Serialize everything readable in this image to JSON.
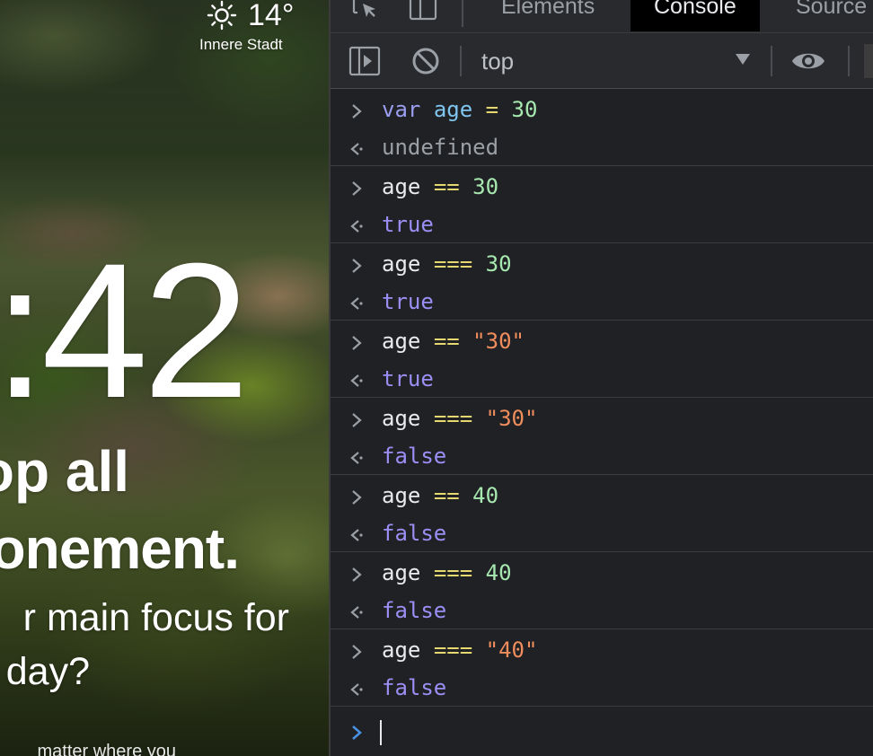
{
  "newtab": {
    "weather": {
      "temp": "14°",
      "location": "Innere Stadt",
      "icon": "sun-icon"
    },
    "clock": ":42",
    "greeting_line1": "op all",
    "greeting_line2": "onement.",
    "focus_line1": "r main focus for",
    "focus_line2": "day?",
    "bottom_text": "matter where you"
  },
  "devtools": {
    "tabs": [
      "Elements",
      "Console",
      "Source"
    ],
    "active_tab": "Console",
    "toolbar": {
      "context": "top",
      "icons": [
        "sidebar-toggle-icon",
        "clear-console-icon",
        "eye-icon"
      ]
    },
    "console": {
      "entries": [
        {
          "input": "var age = 30",
          "output": "undefined"
        },
        {
          "input": "age == 30",
          "output": "true"
        },
        {
          "input": "age === 30",
          "output": "true"
        },
        {
          "input": "age == \"30\"",
          "output": "true"
        },
        {
          "input": "age === \"30\"",
          "output": "false"
        },
        {
          "input": "age == 40",
          "output": "false"
        },
        {
          "input": "age === 40",
          "output": "false"
        },
        {
          "input": "age === \"40\"",
          "output": "false"
        }
      ]
    }
  },
  "colors": {
    "keyword": "#c792ea",
    "variable": "#7fc5ef",
    "operator": "#e5d870",
    "number": "#a7e8b0",
    "string": "#f08d5d",
    "boolean": "#9b8ff5",
    "prompt": "#4a90e2"
  }
}
